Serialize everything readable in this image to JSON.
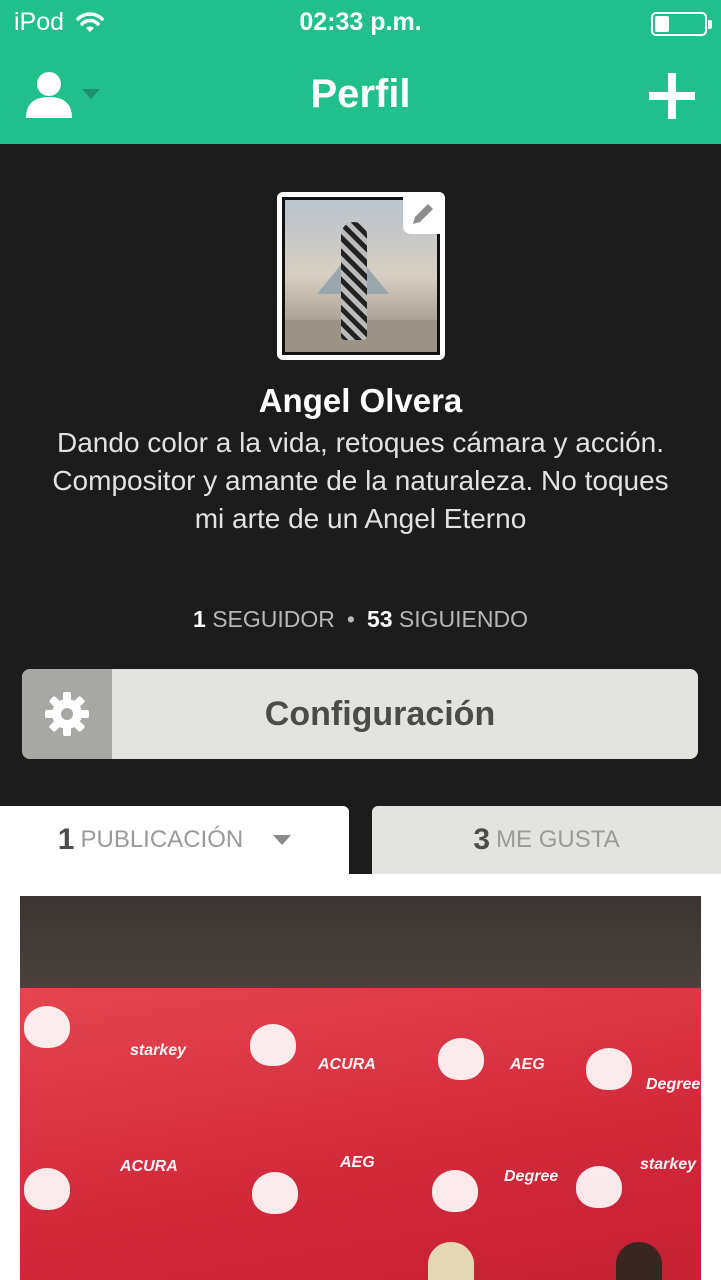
{
  "status_bar": {
    "carrier": "iPod",
    "time": "02:33 p.m.",
    "battery_level": 0.35
  },
  "nav": {
    "title": "Perfil"
  },
  "profile": {
    "name": "Angel Olvera",
    "bio": "Dando color a la vida, retoques cámara y acción. Compositor y amante de la naturaleza. No toques mi arte de un Angel Eterno",
    "followers_count": "1",
    "followers_label": "SEGUIDOR",
    "following_count": "53",
    "following_label": "SIGUIENDO",
    "separator": "•"
  },
  "settings_button": {
    "label": "Configuración"
  },
  "tabs": [
    {
      "count": "1",
      "label": "PUBLICACIÓN"
    },
    {
      "count": "3",
      "label": "ME GUSTA"
    }
  ],
  "post_logos": [
    "starkey",
    "AEG",
    "Degree",
    "ACURA"
  ]
}
